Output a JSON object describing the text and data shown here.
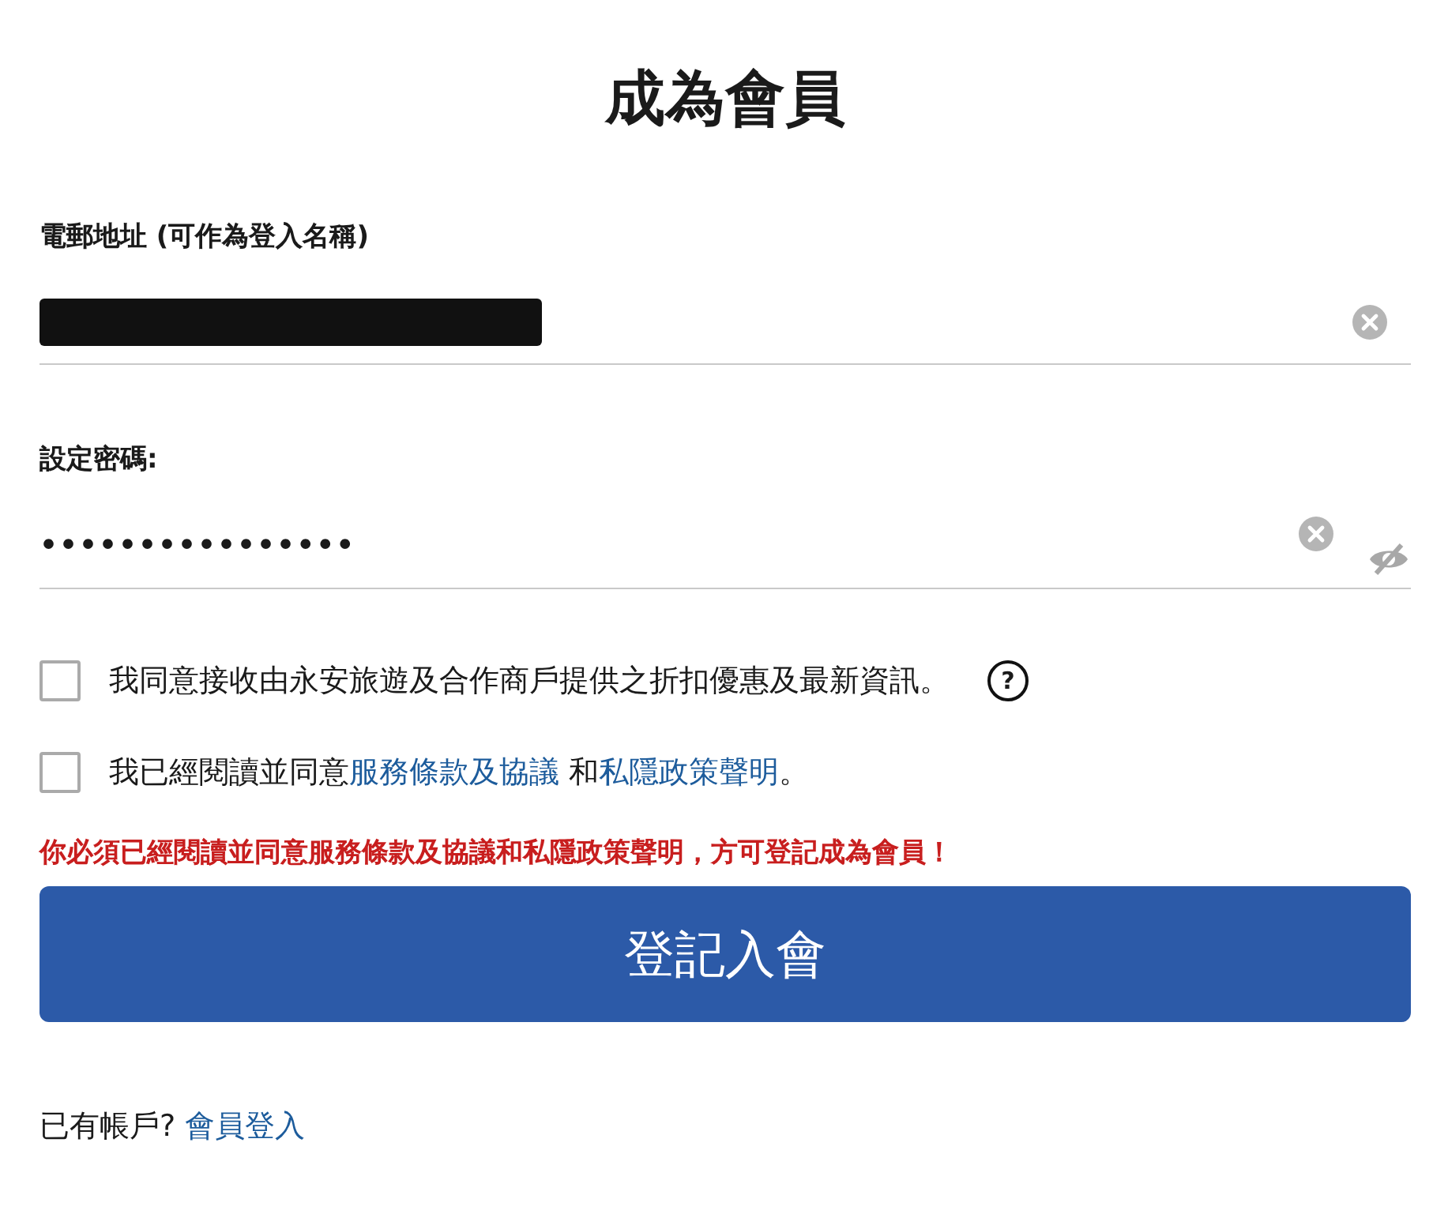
{
  "title": "成為會員",
  "fields": [
    {
      "label": "電郵地址 (可作為登入名稱)",
      "kind": "email",
      "redacted": true
    },
    {
      "label": "設定密碼:",
      "kind": "password",
      "value": "••••••••••••••••"
    }
  ],
  "checkboxes": [
    {
      "checked": false,
      "parts": [
        {
          "text": "我同意接收由永安旅遊及合作商戶提供之折扣優惠及最新資訊。",
          "kind": "text"
        }
      ],
      "help": "?"
    },
    {
      "checked": false,
      "parts": [
        {
          "text": "我已經閱讀並同意",
          "kind": "text"
        },
        {
          "text": "服務條款及協議",
          "kind": "link"
        },
        {
          "text": " 和",
          "kind": "text"
        },
        {
          "text": "私隱政策聲明",
          "kind": "link"
        },
        {
          "text": "。",
          "kind": "text"
        }
      ]
    }
  ],
  "error": "你必須已經閱讀並同意服務條款及協議和私隱政策聲明，方可登記成為會員！",
  "submit": "登記入會",
  "footer": {
    "text": "已有帳戶?",
    "link": "會員登入"
  }
}
